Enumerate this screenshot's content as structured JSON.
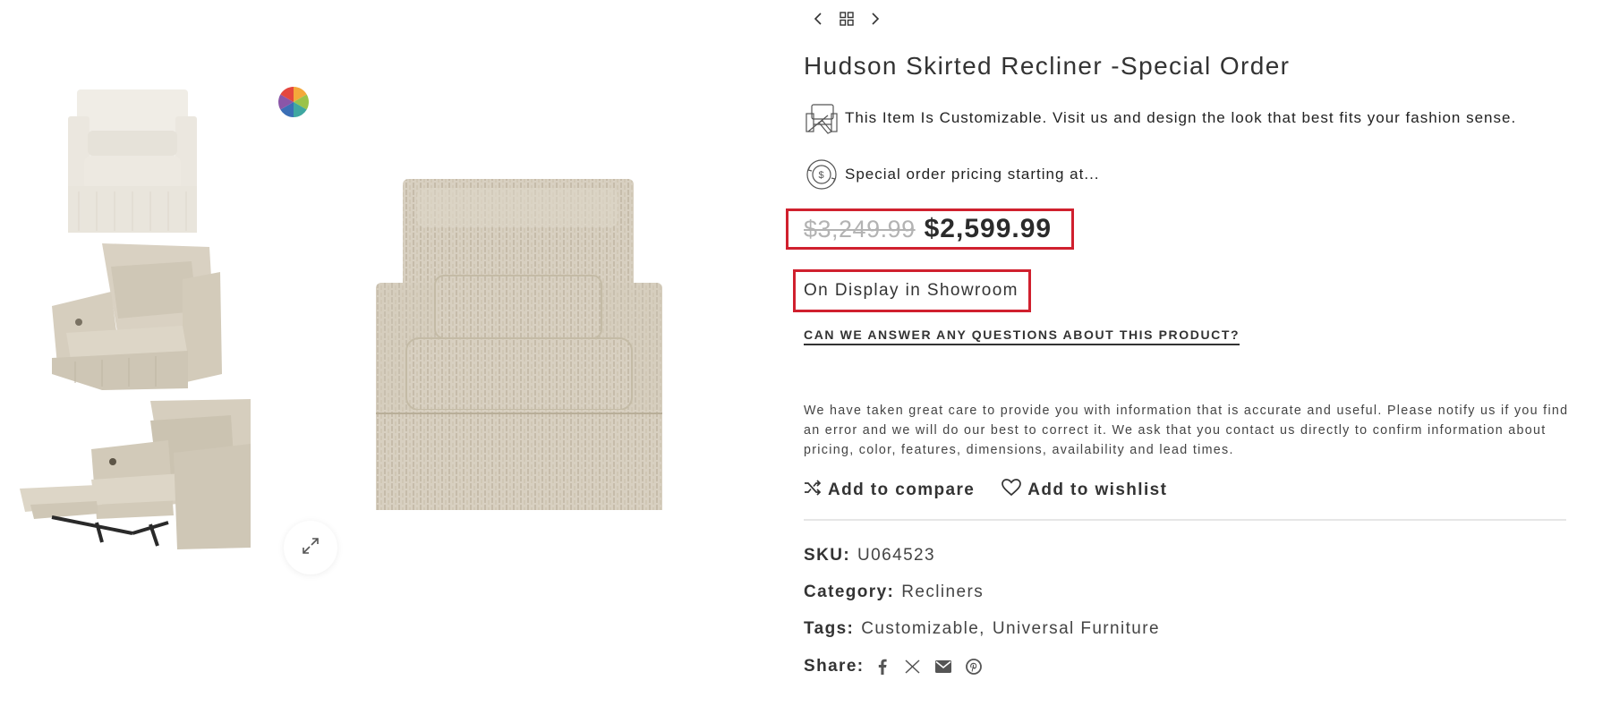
{
  "gallery": {
    "thumbnails": [
      "thumbnail-front",
      "thumbnail-angled",
      "thumbnail-reclined"
    ],
    "main_image": "swivel-recliner-front",
    "icons": {
      "color_swatch": "color-wheel-icon",
      "zoom": "expand-icon"
    }
  },
  "nav": {
    "icons": [
      "chevron-left-icon",
      "grid-icon",
      "chevron-right-icon"
    ]
  },
  "product": {
    "title": "Hudson Skirted Recliner -Special Order",
    "features": [
      {
        "icon": "customize-chair-icon",
        "text": "This Item Is Customizable. Visit us and design the look that best fits your fashion sense."
      },
      {
        "icon": "dollar-cycle-icon",
        "text": "Special order pricing starting at..."
      }
    ],
    "price": {
      "old": "$3,249.99",
      "current": "$2,599.99"
    },
    "availability": "On Display in Showroom",
    "question_link": "CAN WE ANSWER ANY QUESTIONS ABOUT THIS PRODUCT?",
    "disclaimer": "We have taken great care to provide you with information that is accurate and useful. Please notify us if you find an error and we will do our best to correct it. We ask that you contact us directly to confirm information about pricing, color, features, dimensions, availability and lead times.",
    "actions": {
      "compare": "Add to compare",
      "wishlist": "Add to wishlist"
    },
    "meta": {
      "sku_label": "SKU:",
      "sku": "U064523",
      "category_label": "Category:",
      "category": "Recliners",
      "tags_label": "Tags:",
      "tags": [
        "Customizable",
        "Universal Furniture"
      ],
      "tag_separator": ",",
      "share_label": "Share:",
      "share_icons": [
        "facebook-icon",
        "x-icon",
        "email-icon",
        "pinterest-icon"
      ]
    }
  },
  "colors": {
    "highlight_border": "#d0202e",
    "old_price": "#b3b3b3",
    "text": "#333333",
    "upholstery": "#d8d0c1"
  }
}
